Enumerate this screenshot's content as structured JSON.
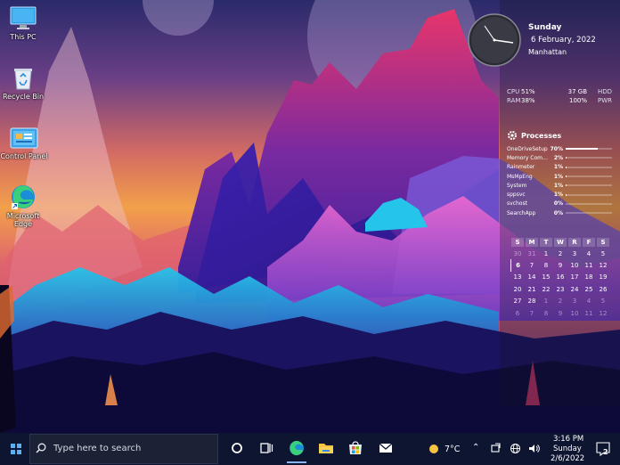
{
  "desktop": {
    "icons": [
      {
        "label": "This PC",
        "icon": "monitor-icon"
      },
      {
        "label": "Recycle Bin",
        "icon": "recycle-bin-icon"
      },
      {
        "label": "Control Panel",
        "icon": "control-panel-icon"
      },
      {
        "label": "Microsoft Edge",
        "icon": "edge-icon"
      }
    ]
  },
  "widget": {
    "day": "Sunday",
    "date": "6 February, 2022",
    "city": "Manhattan",
    "stats": {
      "cpu_label": "CPU",
      "cpu_value": "51%",
      "hdd_value": "37 GB",
      "hdd_label": "HDD",
      "ram_label": "RAM",
      "ram_value": "38%",
      "pwr_value": "100%",
      "pwr_label": "PWR"
    },
    "processes_title": "Processes",
    "processes": [
      {
        "name": "OneDriveSetup",
        "pct": "70%",
        "fill": 0.7
      },
      {
        "name": "Memory Com...",
        "pct": "2%",
        "fill": 0.02
      },
      {
        "name": "Rainmeter",
        "pct": "1%",
        "fill": 0.01
      },
      {
        "name": "MsMpEng",
        "pct": "1%",
        "fill": 0.01
      },
      {
        "name": "System",
        "pct": "1%",
        "fill": 0.01
      },
      {
        "name": "sppsvc",
        "pct": "1%",
        "fill": 0.01
      },
      {
        "name": "svchost",
        "pct": "0%",
        "fill": 0.0
      },
      {
        "name": "SearchApp",
        "pct": "0%",
        "fill": 0.0
      }
    ],
    "calendar": {
      "headers": [
        "S",
        "M",
        "T",
        "W",
        "R",
        "F",
        "S"
      ],
      "weeks": [
        [
          "30",
          "31",
          "1",
          "2",
          "3",
          "4",
          "5"
        ],
        [
          "6",
          "7",
          "8",
          "9",
          "10",
          "11",
          "12"
        ],
        [
          "13",
          "14",
          "15",
          "16",
          "17",
          "18",
          "19"
        ],
        [
          "20",
          "21",
          "22",
          "23",
          "24",
          "25",
          "26"
        ],
        [
          "27",
          "28",
          "1",
          "2",
          "3",
          "4",
          "5"
        ],
        [
          "6",
          "7",
          "8",
          "9",
          "10",
          "11",
          "12"
        ]
      ],
      "today": "6"
    }
  },
  "taskbar": {
    "search_placeholder": "Type here to search",
    "weather": "7°C",
    "time": "3:16 PM",
    "day": "Sunday",
    "date": "2/6/2022",
    "notifications": "2"
  }
}
